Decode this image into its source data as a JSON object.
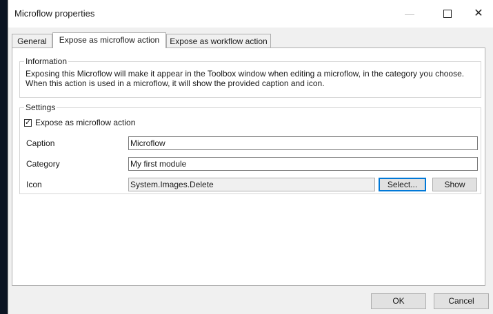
{
  "window": {
    "title": "Microflow properties",
    "minimize_icon": "minimize-icon",
    "maximize_icon": "maximize-icon",
    "close_icon": "close-icon",
    "close_glyph": "✕"
  },
  "tabs": [
    {
      "label": "General",
      "active": false
    },
    {
      "label": "Expose as microflow action",
      "active": true
    },
    {
      "label": "Expose as workflow action",
      "active": false
    }
  ],
  "information": {
    "legend": "Information",
    "text": "Exposing this Microflow will make it appear in the Toolbox window when editing a microflow, in the category you choose. When this action is used in a microflow, it will show the provided caption and icon."
  },
  "settings": {
    "legend": "Settings",
    "expose_checkbox": {
      "label": "Expose as microflow action",
      "checked": true,
      "check_glyph": "✓"
    },
    "caption": {
      "label": "Caption",
      "value": "Microflow"
    },
    "category": {
      "label": "Category",
      "value": "My first module"
    },
    "icon": {
      "label": "Icon",
      "value": "System.Images.Delete",
      "select_label": "Select...",
      "show_label": "Show"
    }
  },
  "footer": {
    "ok_label": "OK",
    "cancel_label": "Cancel"
  },
  "colors": {
    "accent": "#0078d7",
    "dialog_bg": "#f0f0f0",
    "backdrop": "#0b1422"
  }
}
